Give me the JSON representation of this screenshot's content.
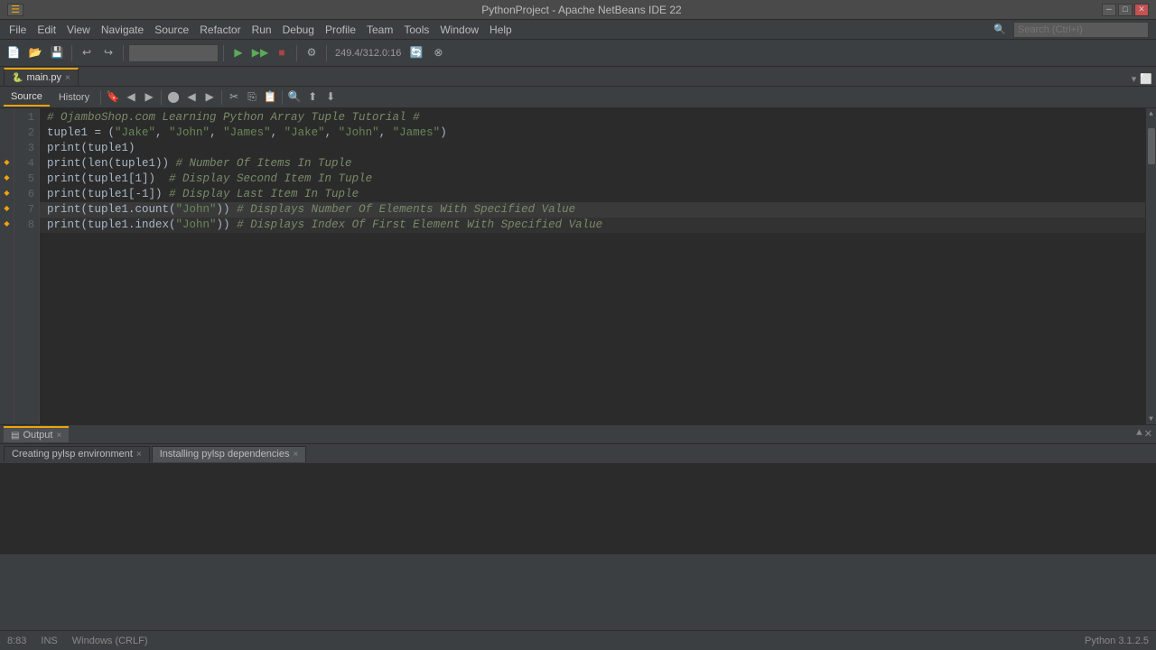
{
  "window": {
    "title": "PythonProject - Apache NetBeans IDE 22"
  },
  "titlebar": {
    "title": "PythonProject - Apache NetBeans IDE 22",
    "minimize": "─",
    "maximize": "□",
    "close": "✕"
  },
  "menubar": {
    "items": [
      "File",
      "Edit",
      "View",
      "Navigate",
      "Source",
      "Refactor",
      "Run",
      "Debug",
      "Profile",
      "Team",
      "Tools",
      "Window",
      "Help"
    ]
  },
  "toolbar": {
    "search_placeholder": "Search (Ctrl+I)",
    "build_field": "",
    "coords": "249.4/312.0:16"
  },
  "filetab": {
    "name": "main.py",
    "close": "×"
  },
  "subtoolbar": {
    "source_label": "Source",
    "history_label": "History"
  },
  "code": {
    "lines": [
      {
        "num": "1",
        "content": "# OjamboShop.com Learning Python Array Tuple Tutorial #",
        "type": "comment"
      },
      {
        "num": "2",
        "content": "tuple1 = (\"Jake\", \"John\", \"James\", \"Jake\", \"John\", \"James\")",
        "type": "code"
      },
      {
        "num": "3",
        "content": "print(tuple1)",
        "type": "code"
      },
      {
        "num": "4",
        "content": "print(len(tuple1)) # Number Of Items In Tuple",
        "type": "code"
      },
      {
        "num": "5",
        "content": "print(tuple1[1])  # Display Second Item In Tuple",
        "type": "code"
      },
      {
        "num": "6",
        "content": "print(tuple1[-1]) # Display Last Item In Tuple",
        "type": "code"
      },
      {
        "num": "7",
        "content": "print(tuple1.count(\"John\")) # Displays Number Of Elements With Specified Value",
        "type": "code"
      },
      {
        "num": "8",
        "content": "print(tuple1.index(\"John\")) # Displays Index Of First Element With Specified Value",
        "type": "code"
      }
    ]
  },
  "bottom": {
    "output_tab": "Output",
    "output_close": "×",
    "subtabs": [
      {
        "label": "Creating pylsp environment",
        "close": "×"
      },
      {
        "label": "Installing pylsp dependencies",
        "close": "×"
      }
    ]
  },
  "statusbar": {
    "cursor": "8:83",
    "ins": "INS",
    "line_ending": "Windows (CRLF)",
    "python_version": "Python 3.1.2.5"
  }
}
